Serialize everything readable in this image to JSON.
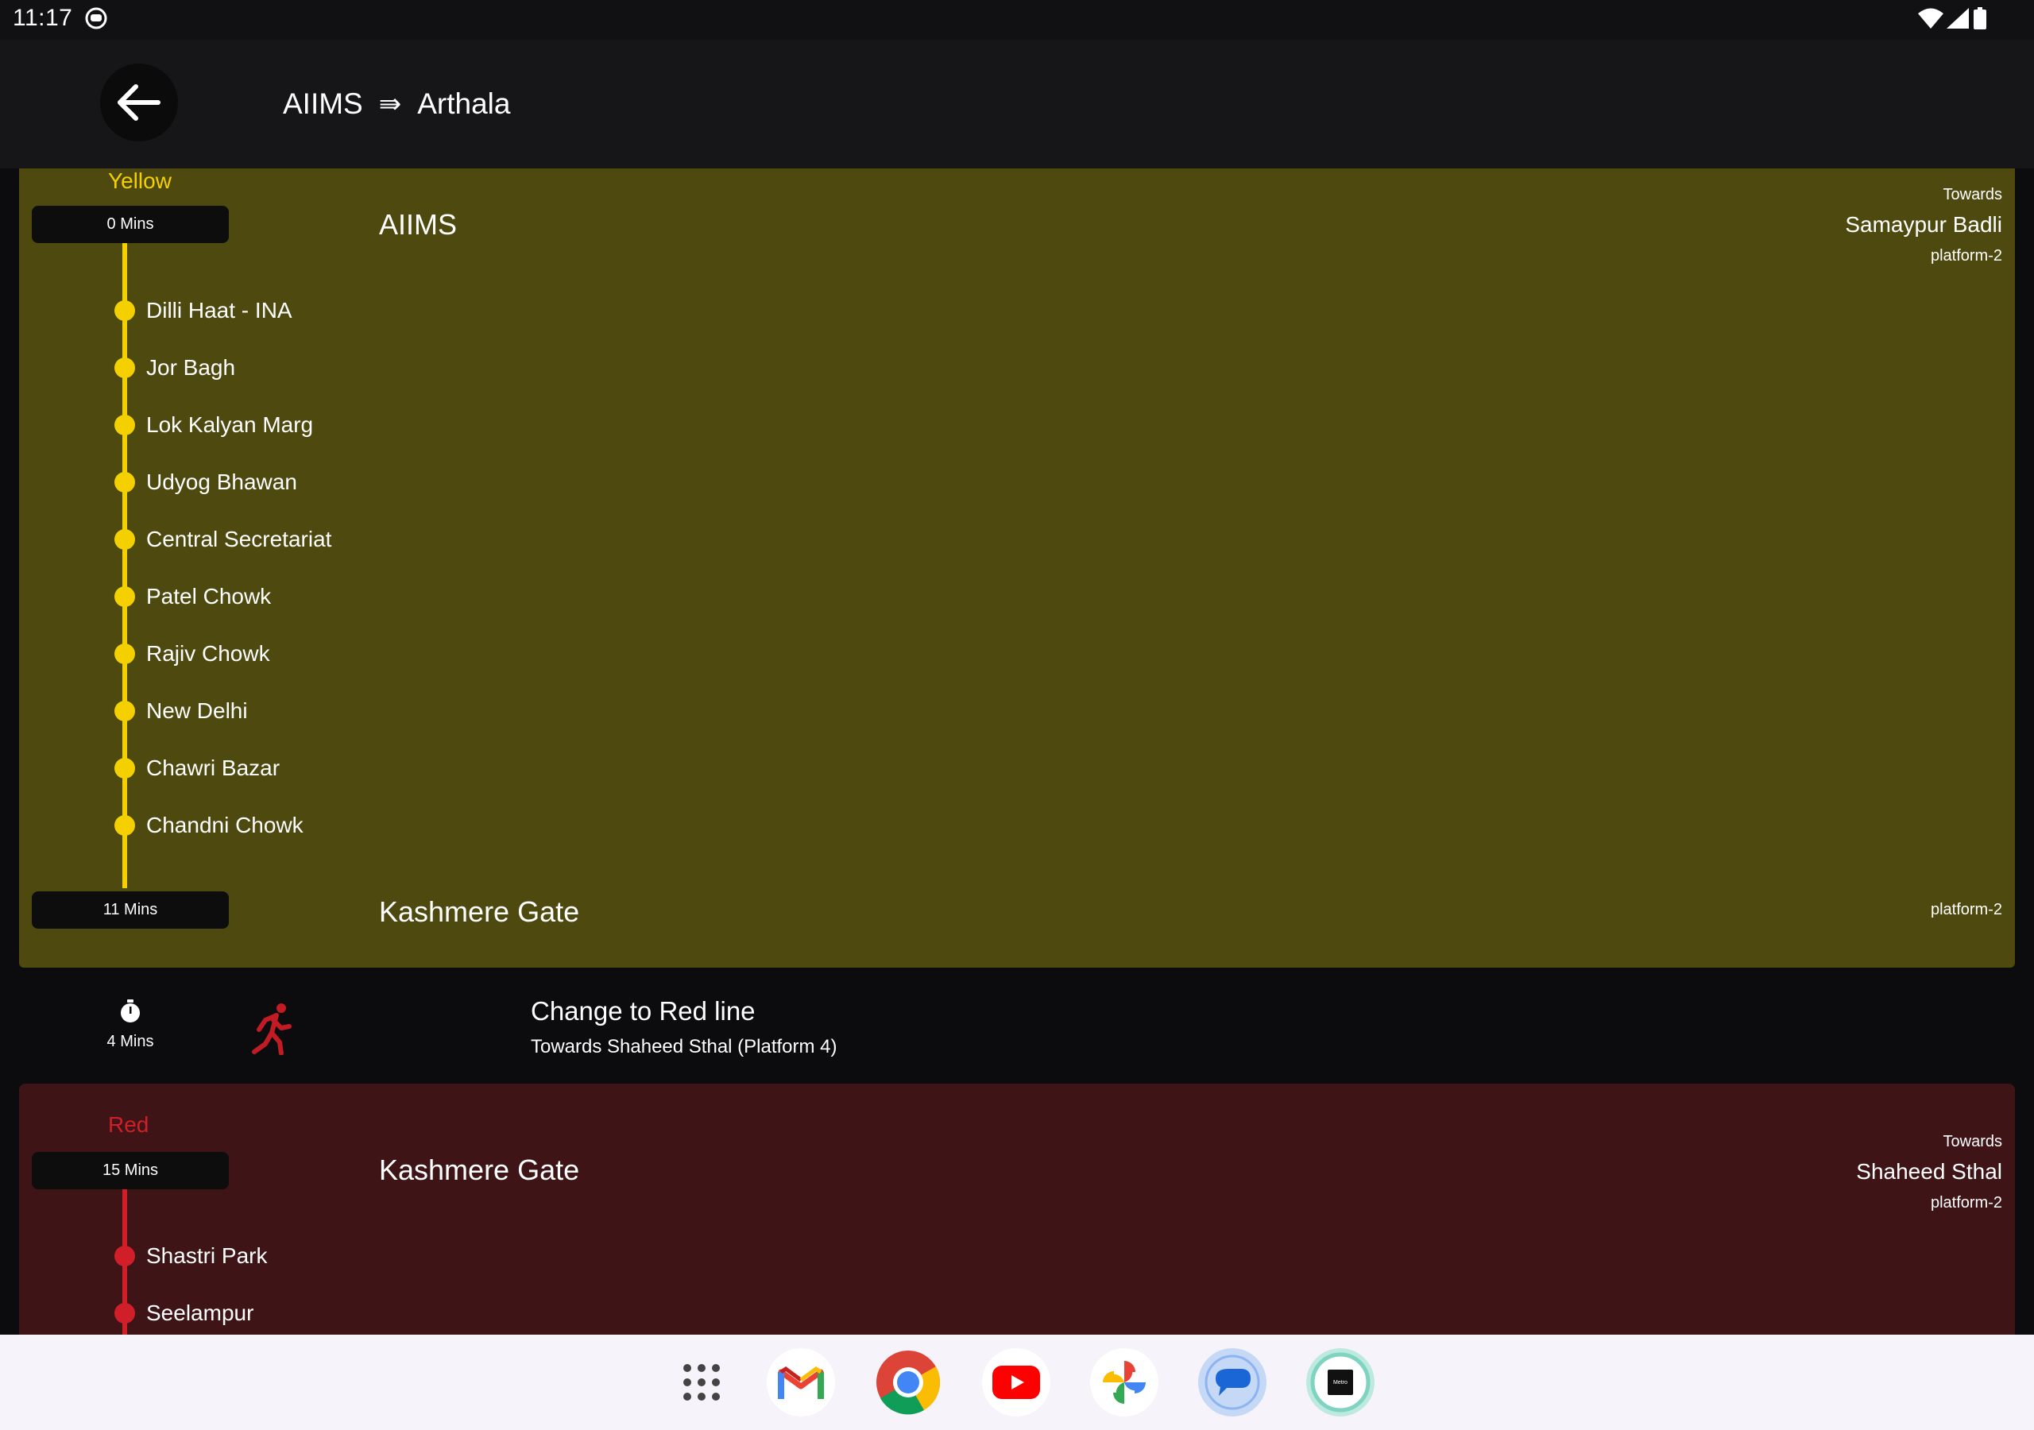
{
  "status_bar": {
    "time": "11:17"
  },
  "header": {
    "from": "AIIMS",
    "arrow": "⇛",
    "to": "Arthala"
  },
  "segments": [
    {
      "line": "Yellow",
      "line_color": "#f5d000",
      "start_time": "0 Mins",
      "end_time": "11 Mins",
      "start_station": "AIIMS",
      "end_station": "Kashmere Gate",
      "towards_caption": "Towards",
      "towards": "Samaypur Badli",
      "platform": "platform-2",
      "end_platform": "platform-2",
      "stops": [
        "Dilli Haat - INA",
        "Jor Bagh",
        "Lok Kalyan Marg",
        "Udyog Bhawan",
        "Central Secretariat",
        "Patel Chowk",
        "Rajiv Chowk",
        "New Delhi",
        "Chawri Bazar",
        "Chandni Chowk"
      ]
    },
    {
      "line": "Red",
      "line_color": "#d11f2a",
      "start_time": "15 Mins",
      "start_station": "Kashmere Gate",
      "towards_caption": "Towards",
      "towards": "Shaheed Sthal",
      "platform": "platform-2",
      "stops": [
        "Shastri Park",
        "Seelampur"
      ]
    }
  ],
  "transfer": {
    "time": "4 Mins",
    "title": "Change to Red line",
    "subtitle": "Towards Shaheed Sthal (Platform 4)"
  },
  "dock": {
    "apps": [
      "app-drawer-icon",
      "gmail-icon",
      "chrome-icon",
      "youtube-icon",
      "photos-icon",
      "messages-icon",
      "metro-app-icon"
    ],
    "metro_label": "Metro"
  }
}
